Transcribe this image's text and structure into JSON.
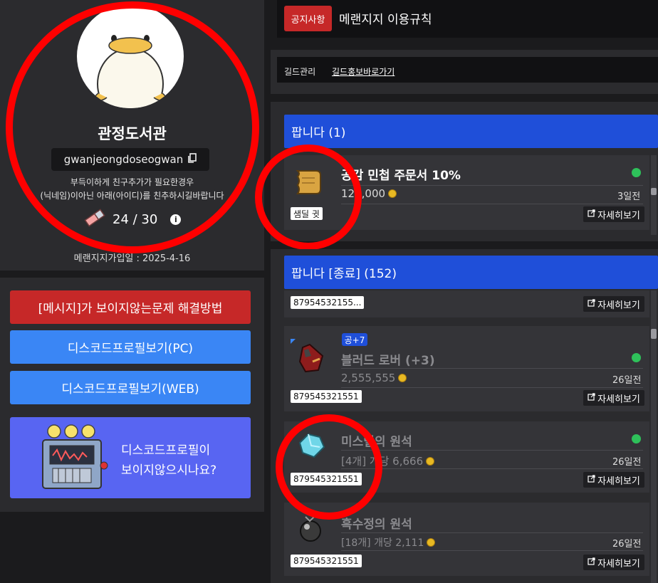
{
  "profile": {
    "nickname": "관정도서관",
    "user_id": "gwanjeongdoseogwan",
    "notice_line1": "부득이하게 친구추가가 필요한경우",
    "notice_line2": "(닉네임)이아닌 아래(아이디)를 친추하시길바랍니다",
    "reputation": "24 / 30",
    "join_date": "메랜지지가입일 : 2025-4-16"
  },
  "links": {
    "message_fix": "[메시지]가 보이지않는문제 해결방법",
    "discord_pc": "디스코드프로필보기(PC)",
    "discord_web": "디스코드프로필보기(WEB)",
    "discord_banner_line1": "디스코드프로필이",
    "discord_banner_line2": "보이지않으시나요?"
  },
  "notice": {
    "badge": "공지사항",
    "title": "메랜지지 이용규칙"
  },
  "guild": {
    "manage": "길드관리",
    "promo": "길드홍보바로가기"
  },
  "selling": {
    "header": "팝니다 (1)",
    "items": [
      {
        "title": "공감 민첩 주문서 10%",
        "price": "120,000",
        "time": "3일전",
        "seller": "샘딜 귓",
        "detail": "자세히보기"
      }
    ]
  },
  "sold": {
    "header": "팝니다 [종료] (152)",
    "items": [
      {
        "seller": "87954532155...",
        "detail": "자세히보기"
      },
      {
        "badge": "공+7",
        "title": "블러드 로버 (+3)",
        "price": "2,555,555",
        "time": "26일전",
        "seller": "879545321551",
        "detail": "자세히보기"
      },
      {
        "title": "미스릴의 원석",
        "price": "[4개] 개당 6,666",
        "time": "26일전",
        "seller": "879545321551",
        "detail": "자세히보기"
      },
      {
        "title": "흑수정의 원석",
        "price": "[18개] 개당 2,111",
        "time": "26일전",
        "seller": "879545321551",
        "detail": "자세히보기"
      }
    ]
  },
  "colors": {
    "accent_blue": "#1f4fd9",
    "danger_red": "#c62828",
    "discord": "#5865f2",
    "online_green": "#2ec15a"
  }
}
